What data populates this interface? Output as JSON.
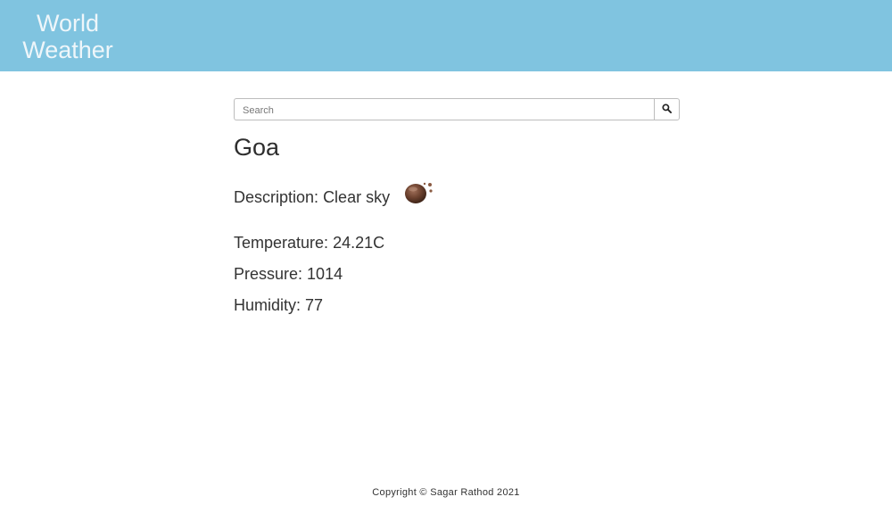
{
  "header": {
    "brand_line1": "World",
    "brand_line2": "Weather",
    "background": "#80c4e0"
  },
  "search": {
    "placeholder": "Search",
    "value": "",
    "button_icon": "search-icon"
  },
  "weather": {
    "city": "Goa",
    "description_label": "Description:",
    "description_value": "Clear sky",
    "icon": "clear-sky-weather-icon",
    "temperature_label": "Temperature:",
    "temperature_value": "24.21C",
    "pressure_label": "Pressure:",
    "pressure_value": "1014",
    "humidity_label": "Humidity:",
    "humidity_value": "77"
  },
  "footer": {
    "copyright": "Copyright © Sagar Rathod 2021"
  }
}
